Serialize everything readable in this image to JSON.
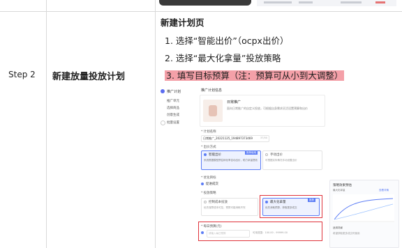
{
  "table": {
    "step": "Step 2",
    "title": "新建放量投放计划",
    "section_title": "新建计划页",
    "steps": [
      "1. 选择“智能出价”（ocpx出价）",
      "2. 选择“最大化拿量”投放策略"
    ],
    "step3": "3. 填写目标预算（注：预算可从小到大调整）"
  },
  "screenshot": {
    "sidebar": {
      "header": "推广计划",
      "items": [
        "推广单元",
        "选择商品",
        "创意生成",
        "批量设置"
      ]
    },
    "panel_title": "推广计划信息",
    "product_title": "日常推广",
    "product_desc": "面向日常推广的自定义投放，可根据自身需求灵活设置预算和出价",
    "plan_name_label": "* 计划名称",
    "plan_name_value": "日常推广_20221125_194897373469",
    "plan_name_count": "37/50",
    "bid_label": "* 出价方式",
    "smart_bid": "智能出价",
    "smart_bid_tag": "推荐使用",
    "smart_bid_desc": "系统根据模型预估转化率自动出价，助力拿量提效",
    "manual_bid": "手动出价",
    "manual_bid_desc": "可根据实际情况手动设置出价",
    "goal_label": "* 优化目标",
    "goal_value": "促进成交",
    "strategy_label": "* 投放策略",
    "strategy_a": "控制成本投放",
    "strategy_a_desc": "优先保障成本可控，预算可能消耗不完",
    "strategy_b": "最大化拿量",
    "strategy_b_tag": "推荐",
    "strategy_b_desc": "优先消耗预算，获取更多成交",
    "budget_label": "* 每日预算(元)",
    "budget_placeholder": "请输入每日预算",
    "budget_hint": "可用范围：100.00 - 99999.00",
    "side_title": "策略效果预估",
    "side_sub": "最大化拿量",
    "side_link": "查看详情",
    "side_note1": "适用场景",
    "side_note2": "希望获取更多成交时使用"
  }
}
